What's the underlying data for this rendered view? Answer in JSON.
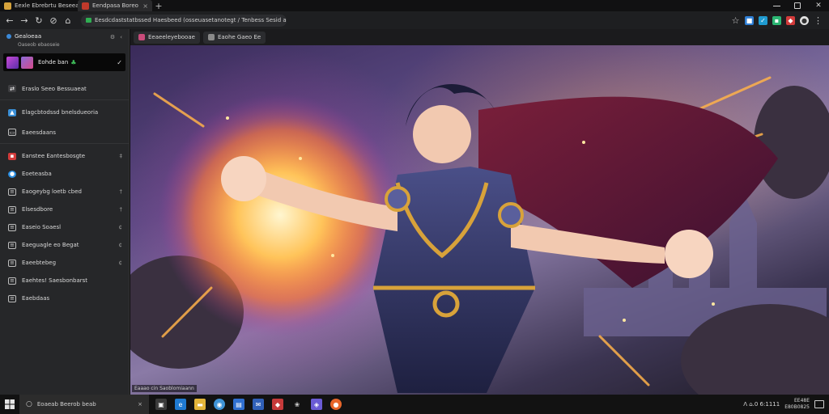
{
  "browser": {
    "tabs": [
      {
        "label": "Eexle Ebrebrtu Beseea",
        "favicon_color": "#d6a33c"
      },
      {
        "label": "Eendpasa Boreo",
        "favicon_color": "#c0392b"
      }
    ],
    "new_tab_symbol": "+",
    "close_symbol": "×",
    "address": "Eesdcdaststatbssed Haesbeed (osseuasetanotegt / Tenbess Sesid a seod)",
    "toolbar_icons": [
      "star-icon",
      "extension-blue-icon",
      "extension-teal-icon",
      "extension-green-icon",
      "extension-red-icon",
      "profile-icon",
      "menu-icon"
    ]
  },
  "sidebar": {
    "header_title": "Gealoeaa",
    "header_sub": "Oaseob ebaoseie",
    "profile_label": "Eohde ban",
    "items": [
      {
        "label": "Eraslo Seeo Bessuaeat",
        "icon": "arrow-icon",
        "color": "#3f3f42",
        "trail": "",
        "separator": true
      },
      {
        "label": "Elagcbtodssd bnelsdueoria",
        "icon": "image-icon",
        "color": "#3a8fd6",
        "trail": ""
      },
      {
        "label": "Eaeesdaans",
        "icon": "folder-icon",
        "color": "#3f3f42",
        "trail": "",
        "separator": true
      },
      {
        "label": "Eanstee Eantesbosgte",
        "icon": "red-app-icon",
        "color": "#d23b3b",
        "trail": "‡"
      },
      {
        "label": "Eoeteasba",
        "icon": "blue-app-icon",
        "color": "#2a8de0",
        "trail": ""
      },
      {
        "label": "Eaogeybg loetb cbed",
        "icon": "doc-icon",
        "color": "#4a4a4d",
        "trail": "†"
      },
      {
        "label": "Elsesdbore",
        "icon": "doc-icon",
        "color": "#4a4a4d",
        "trail": "†"
      },
      {
        "label": "Easeio Soaesl",
        "icon": "doc-icon",
        "color": "#4a4a4d",
        "trail": "¢"
      },
      {
        "label": "Eaeguagle eo Begat",
        "icon": "doc-icon",
        "color": "#4a4a4d",
        "trail": "¢"
      },
      {
        "label": "Eaeebtebeg",
        "icon": "doc-icon",
        "color": "#4a4a4d",
        "trail": "¢"
      },
      {
        "label": "Eaehtes! Saesbonbarst",
        "icon": "doc-icon",
        "color": "#4a4a4d",
        "trail": ""
      },
      {
        "label": "Eaebdaas",
        "icon": "doc-icon",
        "color": "#4a4a4d",
        "trail": ""
      }
    ]
  },
  "content": {
    "tabs": [
      {
        "label": "Eeaeeleyebooae",
        "favicon_color": "#c94b7a"
      },
      {
        "label": "Eaohe Gaeo Ee",
        "favicon_color": "#8a8a8a"
      }
    ],
    "caption": "Eaaao cin Saoblomiaann"
  },
  "taskbar": {
    "search_text": "Eoaeab Beerob beab",
    "search_close": "×",
    "apps": [
      {
        "name": "task-view-icon",
        "color": "#3a3a3a"
      },
      {
        "name": "edge-icon",
        "color": "#1f7ad1"
      },
      {
        "name": "file-explorer-icon",
        "color": "#e3b53a"
      },
      {
        "name": "chrome-icon",
        "color": "#3f93d6"
      },
      {
        "name": "store-icon",
        "color": "#2f6fd0"
      },
      {
        "name": "mail-icon",
        "color": "#3060b8"
      },
      {
        "name": "red-app-icon",
        "color": "#c63a3a"
      },
      {
        "name": "paw-icon",
        "color": "#d0d0d0"
      },
      {
        "name": "purple-app-icon",
        "color": "#6a5bd6"
      },
      {
        "name": "firefox-icon",
        "color": "#e8662a"
      }
    ],
    "tray_text": "ᐱ  ⌂.0  6:1111",
    "clock_time": "EE48E",
    "clock_date": "E80B0825"
  }
}
